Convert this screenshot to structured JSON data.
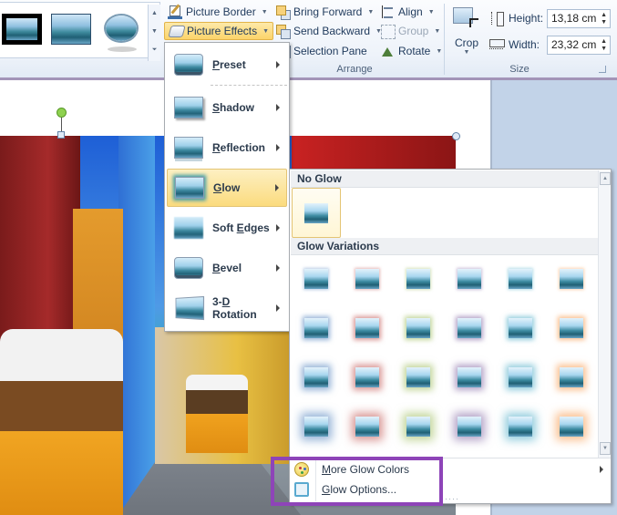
{
  "ribbon": {
    "picture_styles": [
      "Black frame style",
      "Thin border style",
      "Oval style"
    ],
    "picture_border": "Picture Border",
    "picture_effects": "Picture Effects",
    "bring_forward": "Bring Forward",
    "send_backward": "Send Backward",
    "selection_pane": "Selection Pane",
    "align": "Align",
    "group": "Group",
    "rotate": "Rotate",
    "arrange_label": "Arrange",
    "crop": "Crop",
    "height_label": "Height:",
    "height_value": "13,18 cm",
    "width_label": "Width:",
    "width_value": "23,32 cm",
    "size_label": "Size"
  },
  "effects_menu": {
    "items": [
      {
        "pre": "",
        "accel": "P",
        "post": "reset",
        "state": "normal"
      },
      {
        "pre": "",
        "accel": "S",
        "post": "hadow",
        "state": "normal"
      },
      {
        "pre": "",
        "accel": "R",
        "post": "eflection",
        "state": "normal"
      },
      {
        "pre": "",
        "accel": "G",
        "post": "low",
        "state": "active"
      },
      {
        "pre": "Soft ",
        "accel": "E",
        "post": "dges",
        "state": "normal"
      },
      {
        "pre": "",
        "accel": "B",
        "post": "evel",
        "state": "normal"
      },
      {
        "pre": "3-",
        "accel": "D",
        "post": " Rotation",
        "state": "normal"
      }
    ]
  },
  "glow_gallery": {
    "no_glow_header": "No Glow",
    "variations_header": "Glow Variations",
    "colors": [
      "#4f81bd",
      "#c0504d",
      "#9bbb59",
      "#8064a2",
      "#4bacc6",
      "#f79646"
    ],
    "sizes": [
      "5 pt",
      "8 pt",
      "11 pt",
      "18 pt"
    ],
    "more_colors_pre": "",
    "more_colors_accel": "M",
    "more_colors_post": "ore Glow Colors",
    "options_accel": "G",
    "options_post": "low Options...",
    "highlight_color": "#8e44b8"
  },
  "document": {
    "picture_description": "Yellow trams on a cobbled street in Lisbon"
  }
}
